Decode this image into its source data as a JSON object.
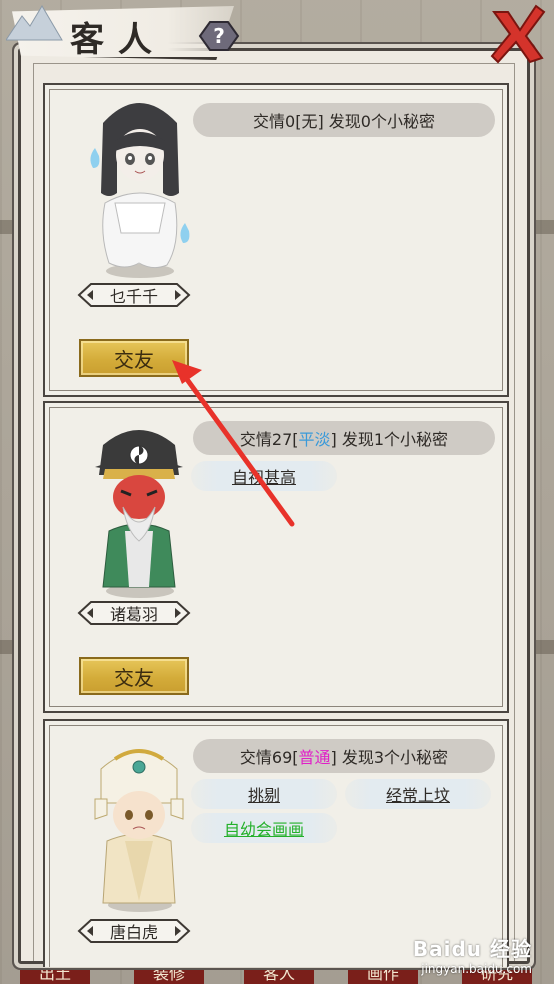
{
  "header": {
    "title": "客人",
    "help_icon": "question-icon",
    "close_icon": "close-x-icon"
  },
  "guests": [
    {
      "name": "乜千千",
      "info_prefix": "交情0[",
      "level": "无",
      "info_suffix": "] 发现0个小秘密",
      "level_color": "#2e2a26",
      "button": "交友",
      "tags": []
    },
    {
      "name": "诸葛羽",
      "info_prefix": "交情27[",
      "level": "平淡",
      "info_suffix": "] 发现1个小秘密",
      "level_color": "#3a9ad9",
      "button": "交友",
      "tags": [
        "自视甚高"
      ]
    },
    {
      "name": "唐白虎",
      "info_prefix": "交情69[",
      "level": "普通",
      "info_suffix": "] 发现3个小秘密",
      "level_color": "#e020c8",
      "tags": [
        "挑剔",
        "经常上坟",
        "自幼会画画"
      ],
      "tag_colors": [
        "#2e2a26",
        "#2e2a26",
        "#24b02a"
      ]
    }
  ],
  "bottom_nav": [
    "出土",
    "装修",
    "客人",
    "画作",
    "研究"
  ],
  "watermark": {
    "brand": "Baidu 经验",
    "url": "jingyan.baidu.com"
  },
  "annotation": {
    "type": "red-arrow",
    "color": "#e8322a"
  }
}
